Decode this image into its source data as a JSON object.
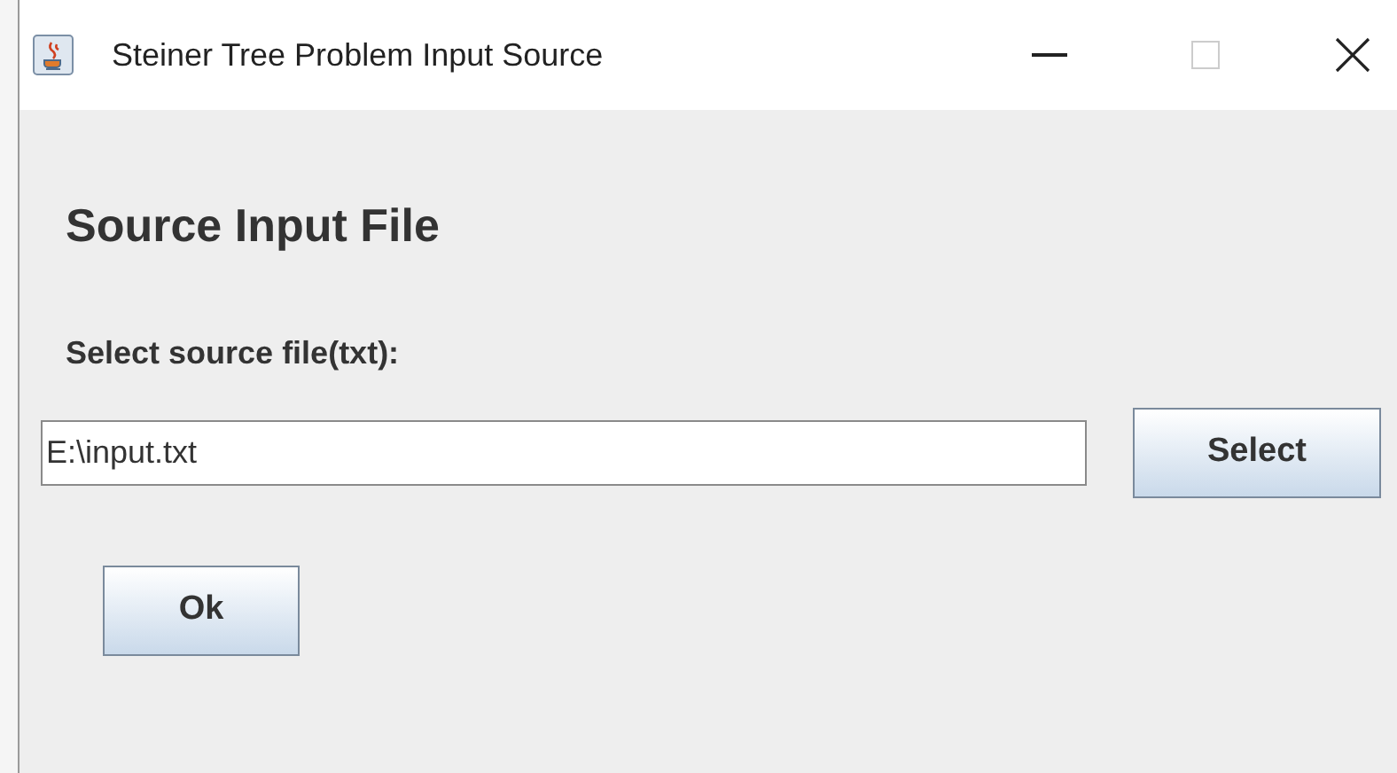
{
  "window": {
    "title": "Steiner Tree Problem Input Source",
    "maximize_disabled": true
  },
  "heading": "Source Input File",
  "field_label": "Select source file(txt):",
  "file_field": {
    "value": "E:\\input.txt"
  },
  "buttons": [
    {
      "label": "Select",
      "kind": "browse"
    },
    {
      "label": "Ok",
      "kind": "confirm"
    }
  ]
}
